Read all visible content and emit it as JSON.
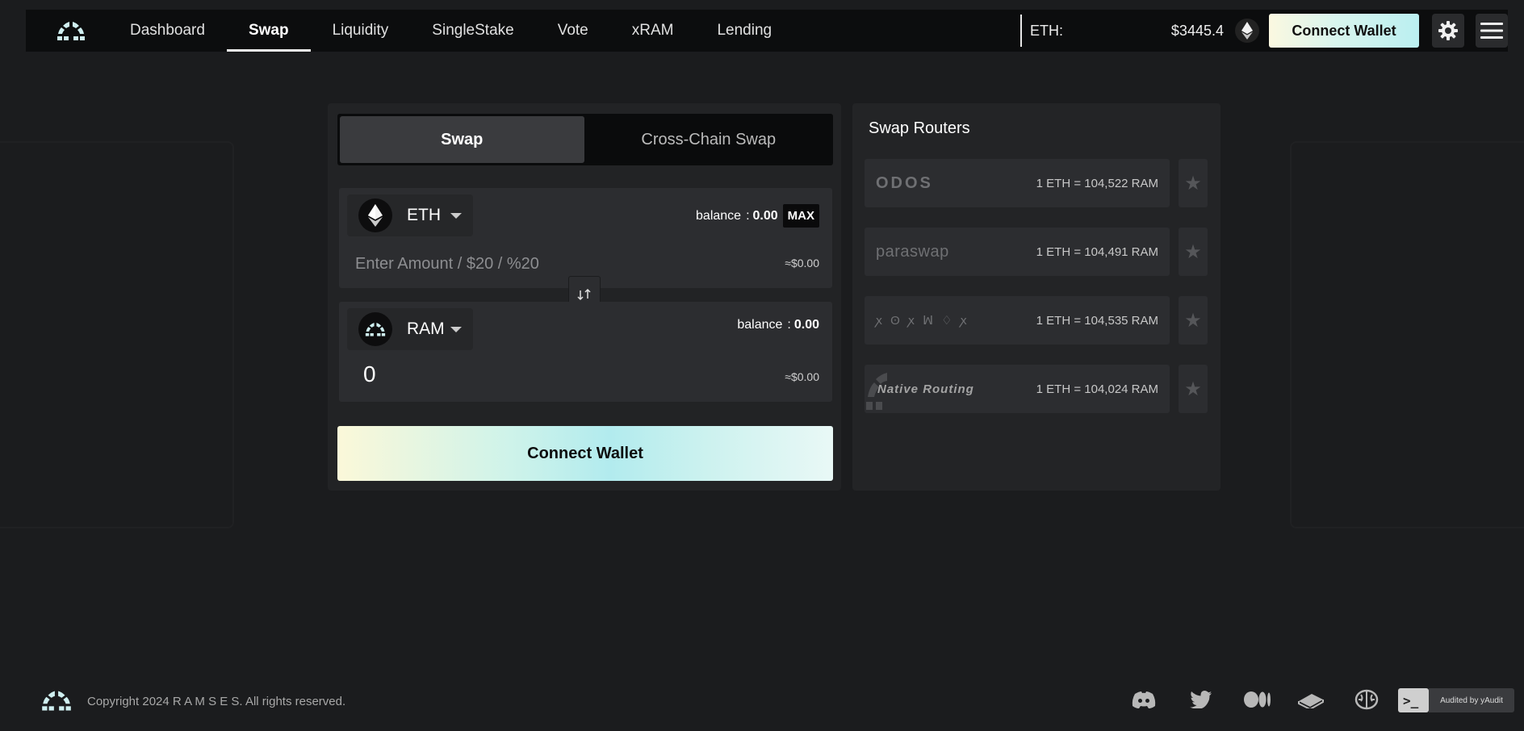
{
  "nav": {
    "links": [
      {
        "label": "Dashboard"
      },
      {
        "label": "Swap"
      },
      {
        "label": "Liquidity"
      },
      {
        "label": "SingleStake"
      },
      {
        "label": "Vote"
      },
      {
        "label": "xRAM"
      },
      {
        "label": "Lending"
      }
    ],
    "active_index": 1,
    "eth_label": "ETH:",
    "eth_price": "$3445.4",
    "connect_label": "Connect Wallet"
  },
  "swap": {
    "tabs": [
      {
        "label": "Swap"
      },
      {
        "label": "Cross-Chain Swap"
      }
    ],
    "from": {
      "token": "ETH",
      "balance_label": "balance",
      "balance_sep": ":",
      "balance": "0.00",
      "max_label": "MAX",
      "placeholder": "Enter Amount / $20 / %20",
      "usd": "≈$0.00"
    },
    "to": {
      "token": "RAM",
      "balance_label": "balance",
      "balance_sep": ":",
      "balance": "0.00",
      "amount": "0",
      "usd": "≈$0.00"
    },
    "connect_label": "Connect Wallet"
  },
  "routers": {
    "title": "Swap Routers",
    "items": [
      {
        "name": "ODOS",
        "rate": "1 ETH = 104,522 RAM"
      },
      {
        "name": "paraswap",
        "rate": "1 ETH = 104,491 RAM"
      },
      {
        "name": "ꭗ ʘ ꭗ ꟽ ♢ ꭗ",
        "rate": "1 ETH = 104,535 RAM"
      },
      {
        "name": "Native Routing",
        "rate": "1 ETH = 104,024 RAM"
      }
    ]
  },
  "footer": {
    "copyright": "Copyright 2024 R A M S E S. All rights reserved.",
    "socials": [
      "discord-icon",
      "twitter-icon",
      "medium-icon",
      "gitbook-icon",
      "brain-icon"
    ],
    "audit": "Audited by yAudit",
    "audit_glyph": ">_"
  },
  "colors": {
    "background": "#1b1c1e",
    "panel": "#222325",
    "input": "#2c2d30",
    "accent_gradient_start": "#fbf8d9",
    "accent_gradient_mid": "#b2ebee"
  }
}
